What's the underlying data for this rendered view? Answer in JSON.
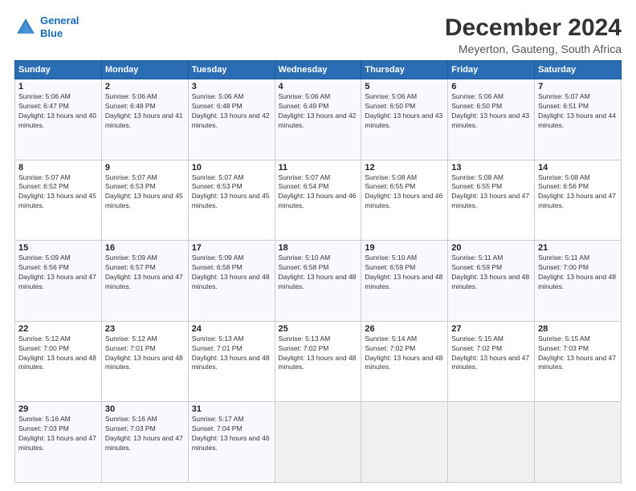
{
  "header": {
    "logo_line1": "General",
    "logo_line2": "Blue",
    "title": "December 2024",
    "subtitle": "Meyerton, Gauteng, South Africa"
  },
  "days_of_week": [
    "Sunday",
    "Monday",
    "Tuesday",
    "Wednesday",
    "Thursday",
    "Friday",
    "Saturday"
  ],
  "weeks": [
    [
      {
        "day": 1,
        "sunrise": "5:06 AM",
        "sunset": "6:47 PM",
        "daylight": "13 hours and 40 minutes."
      },
      {
        "day": 2,
        "sunrise": "5:06 AM",
        "sunset": "6:48 PM",
        "daylight": "13 hours and 41 minutes."
      },
      {
        "day": 3,
        "sunrise": "5:06 AM",
        "sunset": "6:48 PM",
        "daylight": "13 hours and 42 minutes."
      },
      {
        "day": 4,
        "sunrise": "5:06 AM",
        "sunset": "6:49 PM",
        "daylight": "13 hours and 42 minutes."
      },
      {
        "day": 5,
        "sunrise": "5:06 AM",
        "sunset": "6:50 PM",
        "daylight": "13 hours and 43 minutes."
      },
      {
        "day": 6,
        "sunrise": "5:06 AM",
        "sunset": "6:50 PM",
        "daylight": "13 hours and 43 minutes."
      },
      {
        "day": 7,
        "sunrise": "5:07 AM",
        "sunset": "6:51 PM",
        "daylight": "13 hours and 44 minutes."
      }
    ],
    [
      {
        "day": 8,
        "sunrise": "5:07 AM",
        "sunset": "6:52 PM",
        "daylight": "13 hours and 45 minutes."
      },
      {
        "day": 9,
        "sunrise": "5:07 AM",
        "sunset": "6:53 PM",
        "daylight": "13 hours and 45 minutes."
      },
      {
        "day": 10,
        "sunrise": "5:07 AM",
        "sunset": "6:53 PM",
        "daylight": "13 hours and 45 minutes."
      },
      {
        "day": 11,
        "sunrise": "5:07 AM",
        "sunset": "6:54 PM",
        "daylight": "13 hours and 46 minutes."
      },
      {
        "day": 12,
        "sunrise": "5:08 AM",
        "sunset": "6:55 PM",
        "daylight": "13 hours and 46 minutes."
      },
      {
        "day": 13,
        "sunrise": "5:08 AM",
        "sunset": "6:55 PM",
        "daylight": "13 hours and 47 minutes."
      },
      {
        "day": 14,
        "sunrise": "5:08 AM",
        "sunset": "6:56 PM",
        "daylight": "13 hours and 47 minutes."
      }
    ],
    [
      {
        "day": 15,
        "sunrise": "5:09 AM",
        "sunset": "6:56 PM",
        "daylight": "13 hours and 47 minutes."
      },
      {
        "day": 16,
        "sunrise": "5:09 AM",
        "sunset": "6:57 PM",
        "daylight": "13 hours and 47 minutes."
      },
      {
        "day": 17,
        "sunrise": "5:09 AM",
        "sunset": "6:58 PM",
        "daylight": "13 hours and 48 minutes."
      },
      {
        "day": 18,
        "sunrise": "5:10 AM",
        "sunset": "6:58 PM",
        "daylight": "13 hours and 48 minutes."
      },
      {
        "day": 19,
        "sunrise": "5:10 AM",
        "sunset": "6:59 PM",
        "daylight": "13 hours and 48 minutes."
      },
      {
        "day": 20,
        "sunrise": "5:11 AM",
        "sunset": "6:59 PM",
        "daylight": "13 hours and 48 minutes."
      },
      {
        "day": 21,
        "sunrise": "5:11 AM",
        "sunset": "7:00 PM",
        "daylight": "13 hours and 48 minutes."
      }
    ],
    [
      {
        "day": 22,
        "sunrise": "5:12 AM",
        "sunset": "7:00 PM",
        "daylight": "13 hours and 48 minutes."
      },
      {
        "day": 23,
        "sunrise": "5:12 AM",
        "sunset": "7:01 PM",
        "daylight": "13 hours and 48 minutes."
      },
      {
        "day": 24,
        "sunrise": "5:13 AM",
        "sunset": "7:01 PM",
        "daylight": "13 hours and 48 minutes."
      },
      {
        "day": 25,
        "sunrise": "5:13 AM",
        "sunset": "7:02 PM",
        "daylight": "13 hours and 48 minutes."
      },
      {
        "day": 26,
        "sunrise": "5:14 AM",
        "sunset": "7:02 PM",
        "daylight": "13 hours and 48 minutes."
      },
      {
        "day": 27,
        "sunrise": "5:15 AM",
        "sunset": "7:02 PM",
        "daylight": "13 hours and 47 minutes."
      },
      {
        "day": 28,
        "sunrise": "5:15 AM",
        "sunset": "7:03 PM",
        "daylight": "13 hours and 47 minutes."
      }
    ],
    [
      {
        "day": 29,
        "sunrise": "5:16 AM",
        "sunset": "7:03 PM",
        "daylight": "13 hours and 47 minutes."
      },
      {
        "day": 30,
        "sunrise": "5:16 AM",
        "sunset": "7:03 PM",
        "daylight": "13 hours and 47 minutes."
      },
      {
        "day": 31,
        "sunrise": "5:17 AM",
        "sunset": "7:04 PM",
        "daylight": "13 hours and 46 minutes."
      },
      null,
      null,
      null,
      null
    ]
  ]
}
